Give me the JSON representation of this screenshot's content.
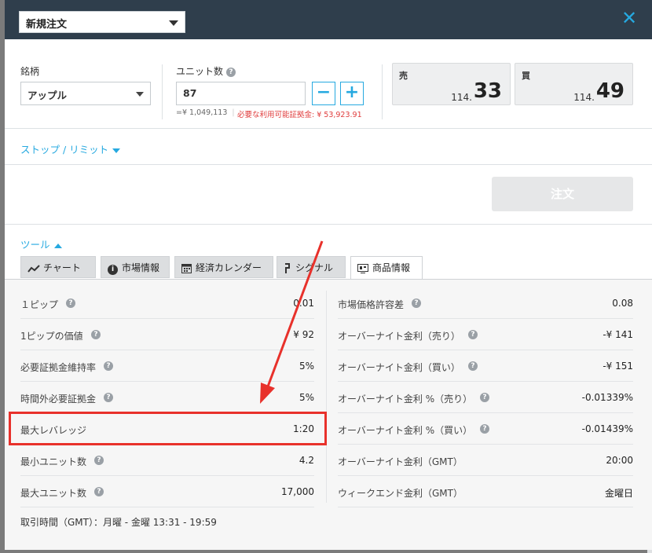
{
  "order_type": {
    "value": "新規注文"
  },
  "close": "✕",
  "symbol": {
    "label": "銘柄",
    "value": "アップル"
  },
  "units": {
    "label": "ユニット数",
    "value": "87",
    "help": "?"
  },
  "notional": "=¥ 1,049,113",
  "margin_required": "必要な利用可能証拠金: ¥ 53,923.91",
  "sell": {
    "side": "売",
    "prefix": "114.",
    "big": "33"
  },
  "buy": {
    "side": "買",
    "prefix": "114.",
    "big": "49"
  },
  "stop_limit": "ストップ / リミット",
  "order_button": "注文",
  "tools": "ツール",
  "tabs": [
    {
      "label": "チャート",
      "icon": "chart-line-icon"
    },
    {
      "label": "市場情報",
      "icon": "info-icon"
    },
    {
      "label": "経済カレンダー",
      "icon": "calendar-icon"
    },
    {
      "label": "シグナル",
      "icon": "signal-icon"
    },
    {
      "label": "商品情報",
      "icon": "product-info-icon"
    }
  ],
  "info_left": [
    {
      "k": "１ピップ",
      "v": "0.01",
      "help": true
    },
    {
      "k": "1ピップの価値",
      "v": "¥ 92",
      "help": true
    },
    {
      "k": "必要証拠金維持率",
      "v": "5%",
      "help": true
    },
    {
      "k": "時間外必要証拠金",
      "v": "5%",
      "help": true
    },
    {
      "k": "最大レバレッジ",
      "v": "1:20",
      "help": false
    },
    {
      "k": "最小ユニット数",
      "v": "4.2",
      "help": true
    },
    {
      "k": "最大ユニット数",
      "v": "17,000",
      "help": true
    }
  ],
  "info_right": [
    {
      "k": "市場価格許容差",
      "v": "0.08",
      "help": true
    },
    {
      "k": "オーバーナイト金利（売り）",
      "v": "-¥ 141",
      "help": true
    },
    {
      "k": "オーバーナイト金利（買い）",
      "v": "-¥ 151",
      "help": true
    },
    {
      "k": "オーバーナイト金利 %（売り）",
      "v": "-0.01339%",
      "help": true
    },
    {
      "k": "オーバーナイト金利 %（買い）",
      "v": "-0.01439%",
      "help": true
    },
    {
      "k": "オーバーナイト金利（GMT）",
      "v": "20:00",
      "help": false
    },
    {
      "k": "ウィークエンド金利（GMT）",
      "v": "金曜日",
      "help": false
    }
  ],
  "trading_hours": "取引時間（GMT）：月曜 - 金曜 13:31 - 19:59",
  "colors": {
    "accent": "#26a9e0",
    "header": "#2f3e4c",
    "alert": "#e03c3c",
    "highlight": "#e8312b"
  }
}
